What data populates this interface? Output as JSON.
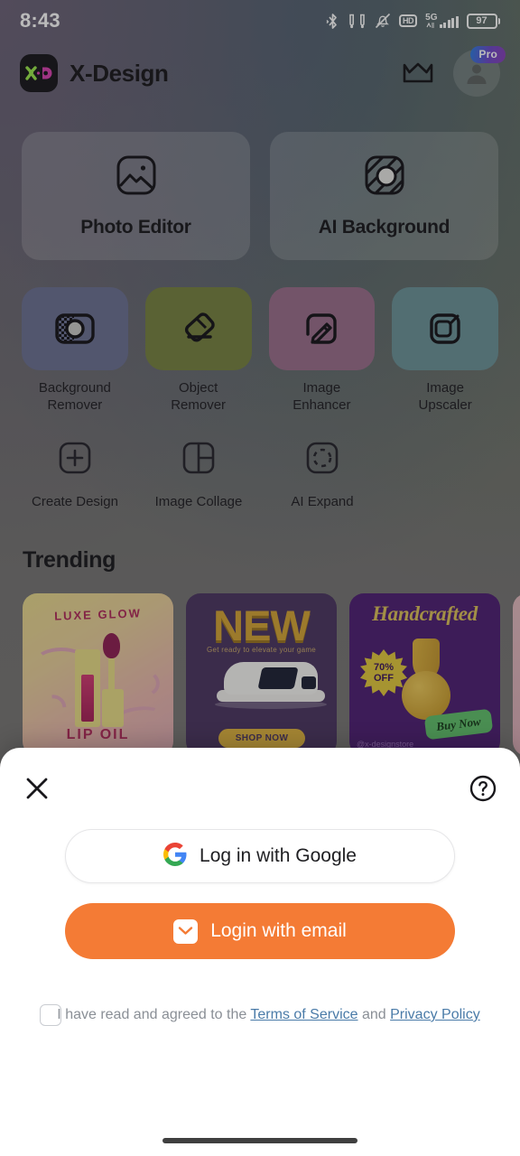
{
  "status_bar": {
    "time": "8:43",
    "battery_percent": "97",
    "network_label": "5G",
    "hd_label": "HD",
    "icons": [
      "bluetooth-icon",
      "earbuds-icon",
      "mute-bell-icon",
      "hd-icon",
      "signal-5g-icon",
      "battery-icon"
    ]
  },
  "app_bar": {
    "brand": "X-Design",
    "logo_letters": {
      "x": "x",
      "d": "D"
    },
    "pro_badge": "Pro",
    "icons": [
      "crown-icon",
      "avatar-icon"
    ]
  },
  "feature_cards": [
    {
      "label": "Photo Editor",
      "icon": "image-icon"
    },
    {
      "label": "AI Background",
      "icon": "ai-background-icon"
    }
  ],
  "tools_row1": [
    {
      "label": "Background\nRemover",
      "line1": "Background",
      "line2": "Remover",
      "icon": "background-remover-icon",
      "color": "#6b7093"
    },
    {
      "label": "Object Remover",
      "line1": "Object",
      "line2": "Remover",
      "icon": "eraser-icon",
      "color": "#76823f"
    },
    {
      "label": "Image Enhancer",
      "line1": "Image",
      "line2": "Enhancer",
      "icon": "magic-wand-icon",
      "color": "#9a6e8b"
    },
    {
      "label": "Image Upscaler",
      "line1": "Image",
      "line2": "Upscaler",
      "icon": "upscale-icon",
      "color": "#6b9299"
    }
  ],
  "tools_row2": [
    {
      "label": "Create Design",
      "icon": "plus-square-icon"
    },
    {
      "label": "Image Collage",
      "icon": "collage-icon"
    },
    {
      "label": "AI Expand",
      "icon": "expand-icon"
    }
  ],
  "trending": {
    "title": "Trending",
    "cards": [
      {
        "name": "lip-oil-template",
        "arc_top": "LUXE GLOW",
        "arc_bottom": "LIP OIL"
      },
      {
        "name": "sneaker-new-template",
        "headline": "NEW",
        "subline": "Get ready to elevate your game",
        "cta": "SHOP NOW"
      },
      {
        "name": "handcrafted-vase-template",
        "headline": "Handcrafted",
        "badge_line1": "70%",
        "badge_line2": "OFF",
        "cta": "Buy Now",
        "handle": "@x-designstore"
      },
      {
        "name": "partial-template",
        "headline": ""
      }
    ]
  },
  "login_sheet": {
    "close_icon": "close-icon",
    "help_icon": "help-circle-icon",
    "google_button": {
      "label": "Log in with Google",
      "icon": "google-icon"
    },
    "email_button": {
      "label": "Login with email",
      "icon": "mail-icon",
      "color": "#f47b35"
    },
    "terms": {
      "prefix": "I have read and agreed to the ",
      "terms_link": "Terms of Service",
      "conjunction": " and ",
      "privacy_link": "Privacy Policy",
      "checked": false
    }
  }
}
